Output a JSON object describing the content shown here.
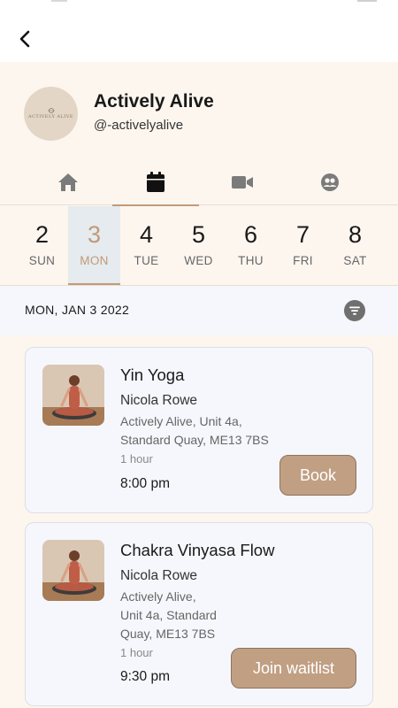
{
  "profile": {
    "name": "Actively Alive",
    "handle": "@-activelyalive",
    "avatar_text": "ACTIVELY ALIVE"
  },
  "tabs": [
    {
      "icon": "home-icon",
      "active": false
    },
    {
      "icon": "calendar-icon",
      "active": true
    },
    {
      "icon": "video-icon",
      "active": false
    },
    {
      "icon": "community-icon",
      "active": false
    }
  ],
  "days": [
    {
      "num": "2",
      "name": "SUN"
    },
    {
      "num": "3",
      "name": "MON"
    },
    {
      "num": "4",
      "name": "TUE"
    },
    {
      "num": "5",
      "name": "WED"
    },
    {
      "num": "6",
      "name": "THU"
    },
    {
      "num": "7",
      "name": "FRI"
    },
    {
      "num": "8",
      "name": "SAT"
    }
  ],
  "selected_date": "MON, JAN 3 2022",
  "classes": [
    {
      "title": "Yin Yoga",
      "instructor": "Nicola Rowe",
      "location_lines": [
        "Actively Alive, Unit 4a,",
        "Standard Quay, ME13 7BS"
      ],
      "duration": "1 hour",
      "time": "8:00 pm",
      "action": "Book"
    },
    {
      "title": "Chakra Vinyasa Flow",
      "instructor": "Nicola Rowe",
      "location_lines": [
        "Actively Alive,",
        "Unit 4a, Standard",
        "Quay, ME13 7BS"
      ],
      "duration": "1 hour",
      "time": "9:30 pm",
      "action": "Join waitlist"
    }
  ],
  "colors": {
    "accent": "#c19a7a",
    "button": "#c19f83",
    "page_bg": "#fdf6ef",
    "card_bg": "#f6f7fc",
    "selected_day_bg": "#e5ebee"
  }
}
